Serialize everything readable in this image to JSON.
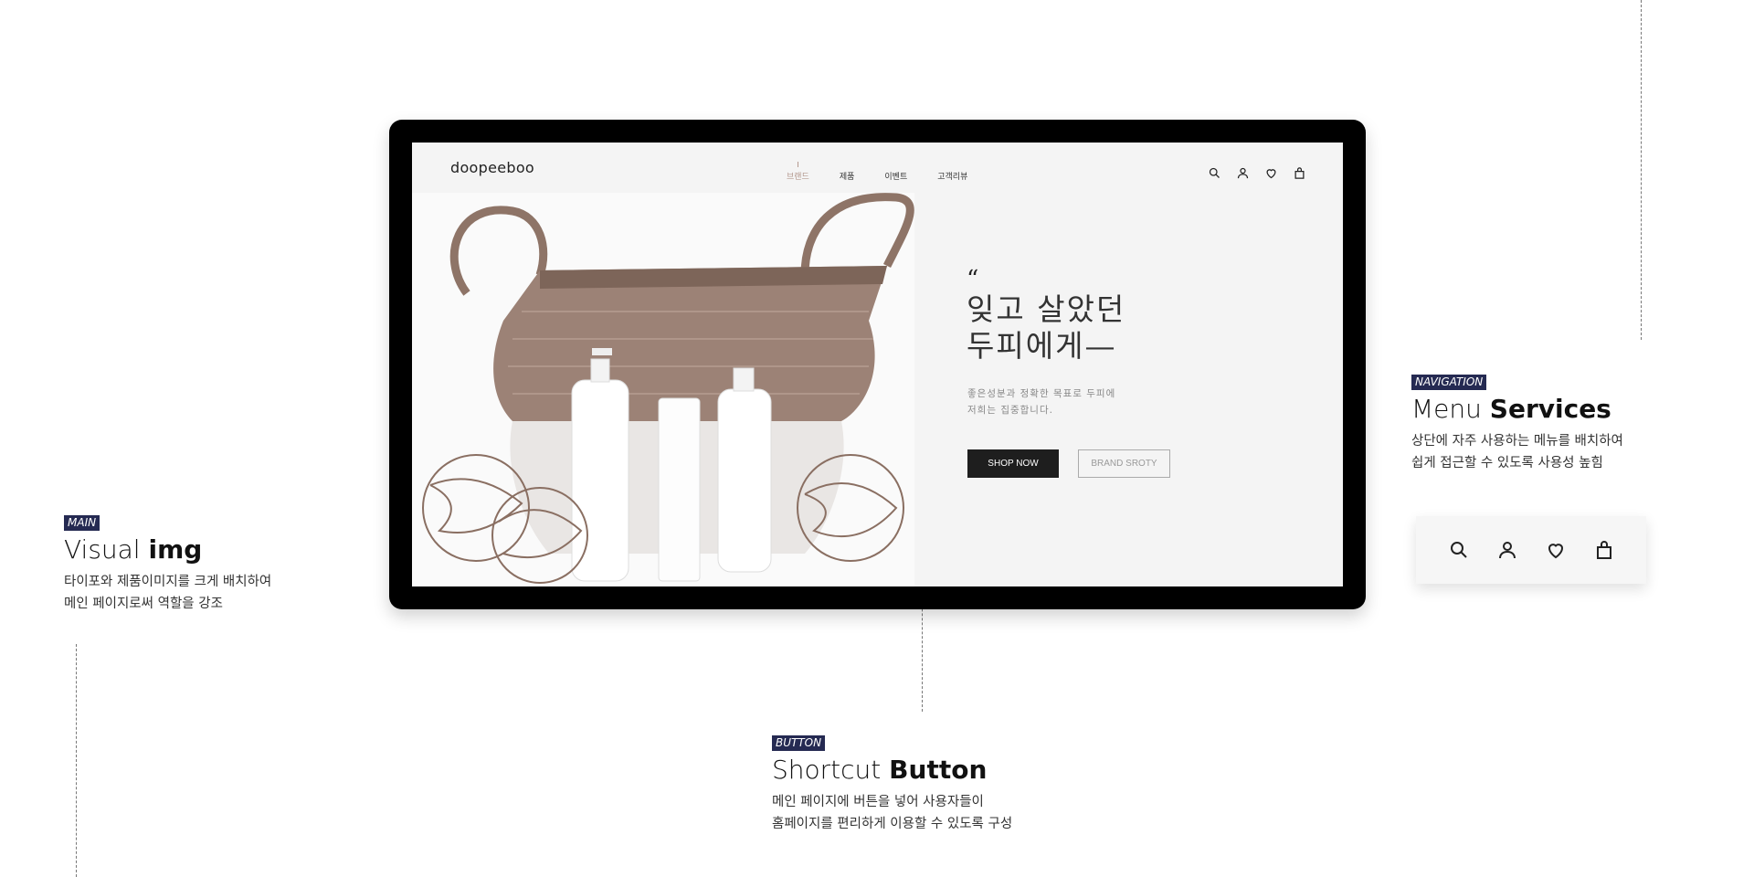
{
  "main_annotation": {
    "tag": "MAIN",
    "title_light": "Visual ",
    "title_bold": "img",
    "desc": [
      "타이포와 제품이미지를 크게 배치하여",
      "메인 페이지로써 역할을 강조"
    ]
  },
  "nav_annotation": {
    "tag": "NAVIGATION",
    "title_light": "Menu ",
    "title_bold": "Services",
    "desc": [
      "상단에 자주 사용하는 메뉴를 배치하여",
      "쉽게 접근할 수 있도록 사용성 높힘"
    ]
  },
  "button_annotation": {
    "tag": "BUTTON",
    "title_light": "Shortcut ",
    "title_bold": "Button",
    "desc": [
      "메인 페이지에 버튼을 넣어 사용자들이",
      "홈페이지를 편리하게 이용할 수 있도록 구성"
    ]
  },
  "site": {
    "logo": "doopeeboo",
    "nav": [
      {
        "label": "브랜드",
        "active": true
      },
      {
        "label": "제품",
        "active": false
      },
      {
        "label": "이벤트",
        "active": false
      },
      {
        "label": "고객리뷰",
        "active": false
      }
    ],
    "utility_icons": [
      "search-icon",
      "user-icon",
      "heart-icon",
      "bag-icon"
    ],
    "hero": {
      "quote_mark": "“",
      "title": [
        "잊고 살았던",
        "두피에게—"
      ],
      "subtitle": [
        "좋은성분과 정확한 목표로 두피에",
        "저희는 집중합니다."
      ],
      "primary_button": "SHOP NOW",
      "secondary_button": "BRAND SROTY"
    }
  },
  "colors": {
    "tag_bg": "#252a52",
    "active_nav": "#b59a90",
    "primary_button_bg": "#1e1e1e",
    "screen_bg": "#f4f4f4"
  }
}
